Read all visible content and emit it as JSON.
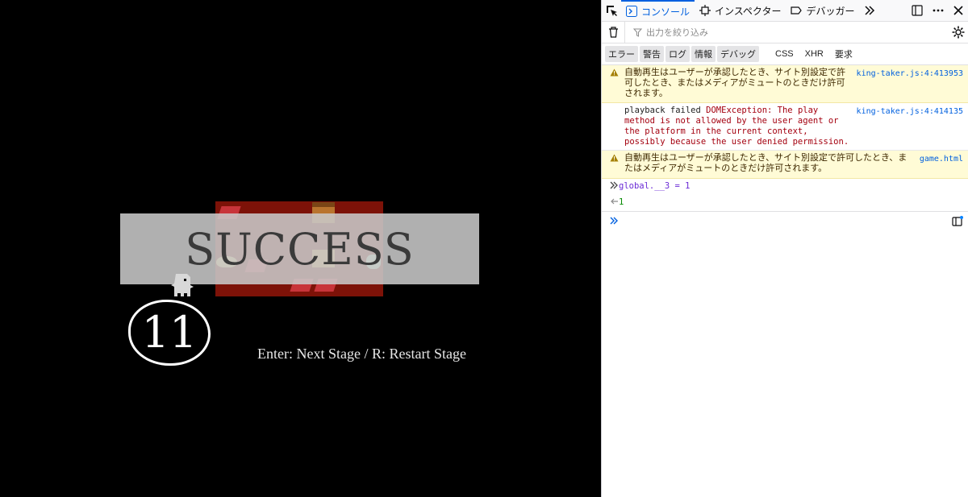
{
  "game": {
    "banner_text": "SUCCESS",
    "moves_left": "11",
    "hint": "Enter: Next Stage / R: Restart Stage"
  },
  "devtools": {
    "tabs": [
      {
        "label": "コンソール",
        "icon": "console-icon",
        "active": true
      },
      {
        "label": "インスペクター",
        "icon": "inspector-icon",
        "active": false
      },
      {
        "label": "デバッガー",
        "icon": "debugger-icon",
        "active": false
      }
    ],
    "filter_placeholder": "出力を絞り込み",
    "levels": [
      "エラー",
      "警告",
      "ログ",
      "情報",
      "デバッグ"
    ],
    "extra_filters": [
      "CSS",
      "XHR",
      "要求"
    ],
    "messages": [
      {
        "type": "warning",
        "text": "自動再生はユーザーが承認したとき、サイト別設定で許可したとき、またはメディアがミュートのときだけ許可されます。",
        "source": "king-taker.js:4:413953"
      },
      {
        "type": "error",
        "prefix": "playback failed",
        "text": "DOMException: The play method is not allowed by the user agent or the platform in the current context, possibly because the user denied permission.",
        "source": "king-taker.js:4:414135"
      },
      {
        "type": "warning",
        "text": "自動再生はユーザーが承認したとき、サイト別設定で許可したとき、またはメディアがミュートのときだけ許可されます。",
        "source": "game.html"
      }
    ],
    "input": "global.__3 = 1",
    "output": "1"
  }
}
